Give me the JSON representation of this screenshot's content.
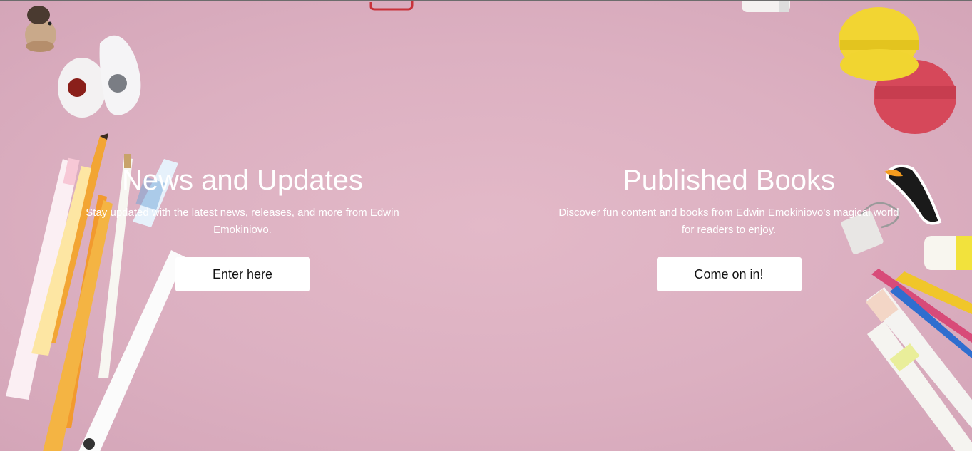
{
  "news": {
    "title": "News and Updates",
    "description": "Stay updated with the latest news, releases, and more from Edwin Emokiniovo.",
    "button_label": "Enter here"
  },
  "books": {
    "title": "Published Books",
    "description": "Discover fun content and books from Edwin Emokiniovo's magical world for readers to enjoy.",
    "button_label": "Come on in!"
  },
  "colors": {
    "background": "#dcb0c1",
    "text": "#ffffff",
    "button_bg": "#ffffff",
    "button_text": "#111111"
  },
  "decorations": [
    "hedgehog-figurine-icon",
    "eraser-icon",
    "pencil-icon",
    "pen-icon",
    "highlighter-icon",
    "macaron-icon",
    "toucan-sticker-icon",
    "binder-clip-icon",
    "paper-clip-icon",
    "crayon-icon",
    "marker-icon"
  ]
}
